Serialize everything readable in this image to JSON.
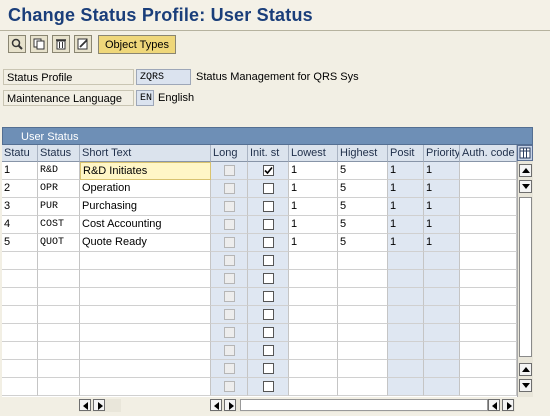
{
  "title": "Change Status Profile: User Status",
  "toolbar": {
    "buttons": [
      {
        "name": "details-button",
        "icon": "magnifier-icon"
      },
      {
        "name": "copy-button",
        "icon": "copy-icon"
      },
      {
        "name": "delete-button",
        "icon": "trash-icon"
      },
      {
        "name": "edit-button",
        "icon": "pencil-icon"
      }
    ],
    "object_types_label": "Object Types"
  },
  "header_fields": {
    "status_profile_label": "Status Profile",
    "status_profile_value": "ZQRS",
    "status_profile_desc": "Status Management for QRS Sys",
    "maint_lang_label": "Maintenance Language",
    "maint_lang_value": "EN",
    "maint_lang_desc": "English"
  },
  "table": {
    "title": "User Status",
    "columns": [
      "Statu",
      "Status",
      "Short Text",
      "Long",
      "Init. st",
      "Lowest",
      "Highest",
      "Posit",
      "Priority",
      "Auth. code"
    ],
    "rows": [
      {
        "num": "1",
        "status": "R&D",
        "text": "R&D Initiates",
        "init": true,
        "lowest": "1",
        "highest": "5",
        "posit": "1",
        "priority": "1"
      },
      {
        "num": "2",
        "status": "OPR",
        "text": "Operation",
        "init": false,
        "lowest": "1",
        "highest": "5",
        "posit": "1",
        "priority": "1"
      },
      {
        "num": "3",
        "status": "PUR",
        "text": "Purchasing",
        "init": false,
        "lowest": "1",
        "highest": "5",
        "posit": "1",
        "priority": "1"
      },
      {
        "num": "4",
        "status": "COST",
        "text": "Cost Accounting",
        "init": false,
        "lowest": "1",
        "highest": "5",
        "posit": "1",
        "priority": "1"
      },
      {
        "num": "5",
        "status": "QUOT",
        "text": "Quote Ready",
        "init": false,
        "lowest": "1",
        "highest": "5",
        "posit": "1",
        "priority": "1"
      }
    ],
    "empty_rows": 8
  },
  "colors": {
    "title": "#1a3e7a",
    "table_title_bg": "#6e8fb6",
    "object_types_bg": "#efd77a",
    "input_bg": "#dbe3ef"
  }
}
